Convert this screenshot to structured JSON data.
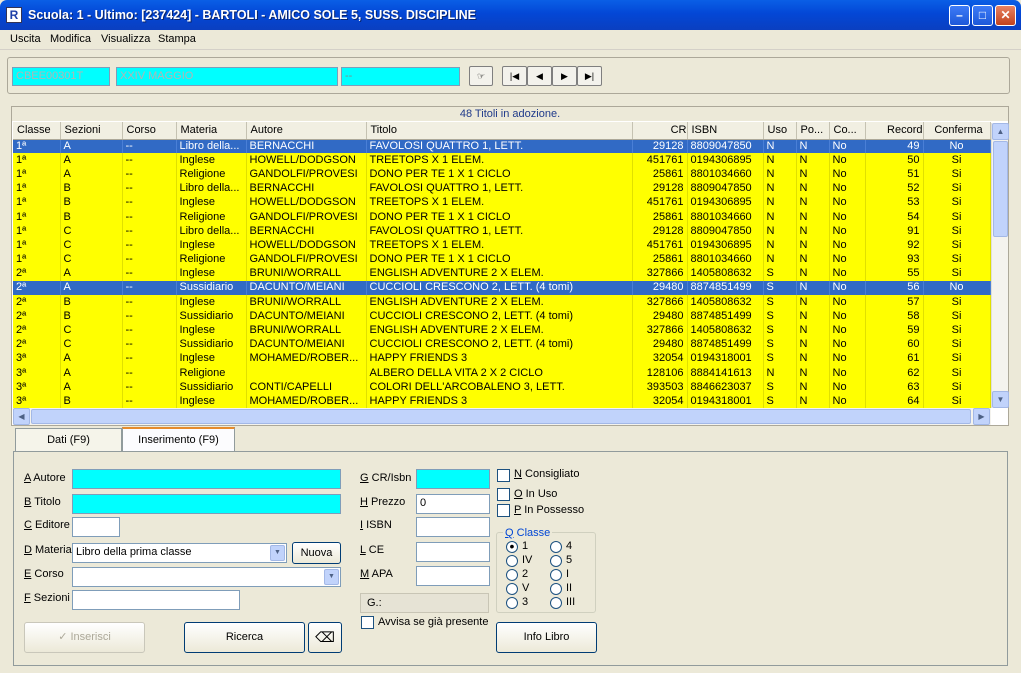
{
  "window": {
    "title": "Scuola: 1 - Ultimo: [237424] - BARTOLI - AMICO SOLE 5, SUSS. DISCIPLINE",
    "app_icon": "R"
  },
  "menu": [
    "Uscita",
    "Modifica",
    "Visualizza",
    "Stampa"
  ],
  "top": {
    "code": "CBEE00301T",
    "school": "XXIV MAGGIO",
    "field3": "--"
  },
  "summary": "48 Titoli in adozione.",
  "columns": [
    "Classe",
    "Sezioni",
    "Corso",
    "Materia",
    "Autore",
    "Titolo",
    "CR",
    "ISBN",
    "Uso",
    "Po...",
    "Co...",
    "Record",
    "Conferma"
  ],
  "rows": [
    [
      "1ª",
      "A",
      "--",
      "Libro della...",
      "BERNACCHI",
      "FAVOLOSI QUATTRO 1, LETT.",
      "29128",
      "8809047850",
      "N",
      "N",
      "No",
      "49",
      "No"
    ],
    [
      "1ª",
      "A",
      "--",
      "Inglese",
      "HOWELL/DODGSON",
      "TREETOPS X 1 ELEM.",
      "451761",
      "0194306895",
      "N",
      "N",
      "No",
      "50",
      "Si"
    ],
    [
      "1ª",
      "A",
      "--",
      "Religione",
      "GANDOLFI/PROVESI",
      "DONO PER TE 1 X 1 CICLO",
      "25861",
      "8801034660",
      "N",
      "N",
      "No",
      "51",
      "Si"
    ],
    [
      "1ª",
      "B",
      "--",
      "Libro della...",
      "BERNACCHI",
      "FAVOLOSI QUATTRO 1, LETT.",
      "29128",
      "8809047850",
      "N",
      "N",
      "No",
      "52",
      "Si"
    ],
    [
      "1ª",
      "B",
      "--",
      "Inglese",
      "HOWELL/DODGSON",
      "TREETOPS X 1 ELEM.",
      "451761",
      "0194306895",
      "N",
      "N",
      "No",
      "53",
      "Si"
    ],
    [
      "1ª",
      "B",
      "--",
      "Religione",
      "GANDOLFI/PROVESI",
      "DONO PER TE 1 X 1 CICLO",
      "25861",
      "8801034660",
      "N",
      "N",
      "No",
      "54",
      "Si"
    ],
    [
      "1ª",
      "C",
      "--",
      "Libro della...",
      "BERNACCHI",
      "FAVOLOSI QUATTRO 1, LETT.",
      "29128",
      "8809047850",
      "N",
      "N",
      "No",
      "91",
      "Si"
    ],
    [
      "1ª",
      "C",
      "--",
      "Inglese",
      "HOWELL/DODGSON",
      "TREETOPS X 1 ELEM.",
      "451761",
      "0194306895",
      "N",
      "N",
      "No",
      "92",
      "Si"
    ],
    [
      "1ª",
      "C",
      "--",
      "Religione",
      "GANDOLFI/PROVESI",
      "DONO PER TE 1 X 1 CICLO",
      "25861",
      "8801034660",
      "N",
      "N",
      "No",
      "93",
      "Si"
    ],
    [
      "2ª",
      "A",
      "--",
      "Inglese",
      "BRUNI/WORRALL",
      "ENGLISH ADVENTURE 2 X ELEM.",
      "327866",
      "1405808632",
      "S",
      "N",
      "No",
      "55",
      "Si"
    ],
    [
      "2ª",
      "A",
      "--",
      "Sussidiario",
      "DACUNTO/MEIANI",
      "CUCCIOLI CRESCONO 2, LETT. (4 tomi)",
      "29480",
      "8874851499",
      "S",
      "N",
      "No",
      "56",
      "No"
    ],
    [
      "2ª",
      "B",
      "--",
      "Inglese",
      "BRUNI/WORRALL",
      "ENGLISH ADVENTURE 2 X ELEM.",
      "327866",
      "1405808632",
      "S",
      "N",
      "No",
      "57",
      "Si"
    ],
    [
      "2ª",
      "B",
      "--",
      "Sussidiario",
      "DACUNTO/MEIANI",
      "CUCCIOLI CRESCONO 2, LETT. (4 tomi)",
      "29480",
      "8874851499",
      "S",
      "N",
      "No",
      "58",
      "Si"
    ],
    [
      "2ª",
      "C",
      "--",
      "Inglese",
      "BRUNI/WORRALL",
      "ENGLISH ADVENTURE 2 X ELEM.",
      "327866",
      "1405808632",
      "S",
      "N",
      "No",
      "59",
      "Si"
    ],
    [
      "2ª",
      "C",
      "--",
      "Sussidiario",
      "DACUNTO/MEIANI",
      "CUCCIOLI CRESCONO 2, LETT. (4 tomi)",
      "29480",
      "8874851499",
      "S",
      "N",
      "No",
      "60",
      "Si"
    ],
    [
      "3ª",
      "A",
      "--",
      "Inglese",
      "MOHAMED/ROBER...",
      "HAPPY FRIENDS 3",
      "32054",
      "0194318001",
      "S",
      "N",
      "No",
      "61",
      "Si"
    ],
    [
      "3ª",
      "A",
      "--",
      "Religione",
      "",
      "ALBERO DELLA VITA 2 X 2 CICLO",
      "128106",
      "8884141613",
      "N",
      "N",
      "No",
      "62",
      "Si"
    ],
    [
      "3ª",
      "A",
      "--",
      "Sussidiario",
      "CONTI/CAPELLI",
      "COLORI DELL'ARCOBALENO 3, LETT.",
      "393503",
      "8846623037",
      "S",
      "N",
      "No",
      "63",
      "Si"
    ],
    [
      "3ª",
      "B",
      "--",
      "Inglese",
      "MOHAMED/ROBER...",
      "HAPPY FRIENDS 3",
      "32054",
      "0194318001",
      "S",
      "N",
      "No",
      "64",
      "Si"
    ]
  ],
  "selected_rows": [
    0,
    10
  ],
  "tabs": [
    "Dati (F9)",
    "Inserimento (F9)"
  ],
  "form": {
    "autore": {
      "key": "A",
      "label": "Autore"
    },
    "titolo": {
      "key": "B",
      "label": "Titolo"
    },
    "editore": {
      "key": "C",
      "label": "Editore"
    },
    "materia": {
      "key": "D",
      "label": "Materia",
      "value": "Libro della prima classe"
    },
    "corso": {
      "key": "E",
      "label": "Corso"
    },
    "sezioni": {
      "key": "F",
      "label": "Sezioni"
    },
    "nuova": "Nuova",
    "crisbn": {
      "key": "G",
      "label": "CR/Isbn"
    },
    "prezzo": {
      "key": "H",
      "label": "Prezzo",
      "value": "0"
    },
    "isbn": {
      "key": "I",
      "label": "ISBN"
    },
    "ce": {
      "key": "L",
      "label": "CE"
    },
    "apa": {
      "key": "M",
      "label": "APA"
    },
    "g_status": "G.:",
    "avvisa": "Avvisa se già presente",
    "consigliato": {
      "key": "N",
      "label": "Consigliato"
    },
    "in_uso": {
      "key": "O",
      "label": "In Uso"
    },
    "in_possesso": {
      "key": "P",
      "label": "In Possesso"
    },
    "classe_group": {
      "key": "Q",
      "label": "Classe"
    },
    "classe_left": [
      "1",
      "IV",
      "2",
      "V",
      "3"
    ],
    "classe_right": [
      "4",
      "5",
      "I",
      "II",
      "III"
    ],
    "inserisci": "Inserisci",
    "ricerca": "Ricerca",
    "info": "Info Libro"
  }
}
